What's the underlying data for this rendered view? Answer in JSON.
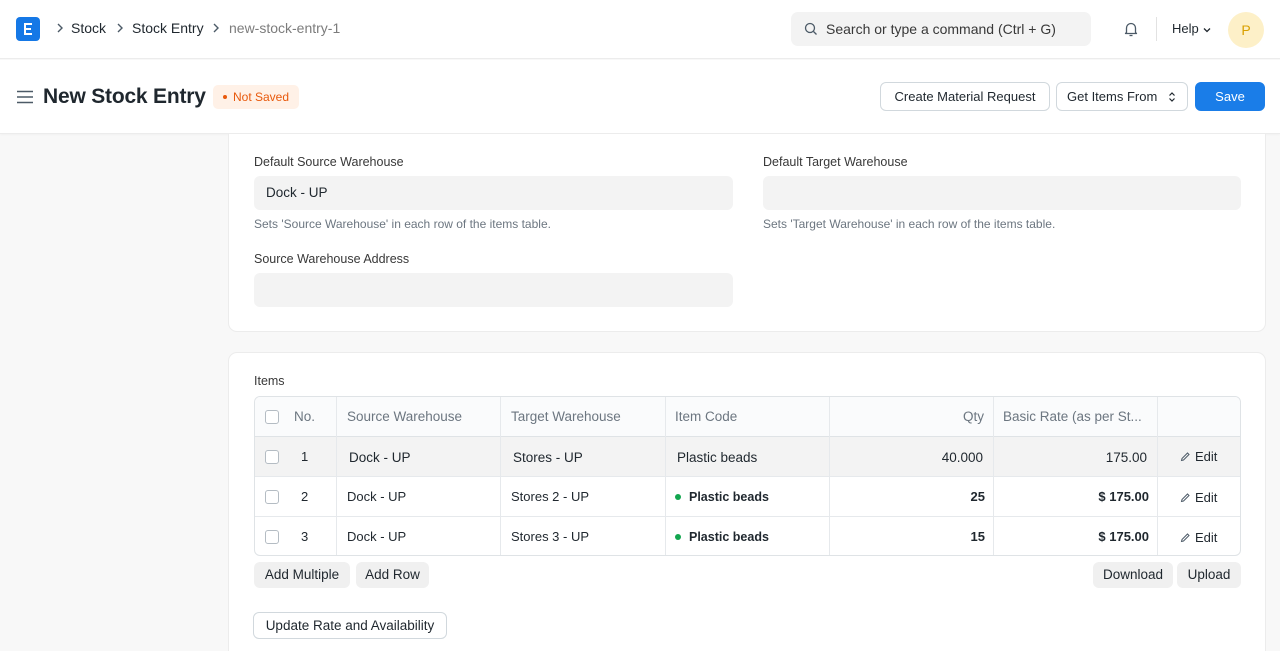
{
  "navbar": {
    "breadcrumbs": [
      "Stock",
      "Stock Entry",
      "new-stock-entry-1"
    ],
    "search_placeholder": "Search or type a command (Ctrl + G)",
    "help_label": "Help",
    "avatar_initial": "P"
  },
  "page": {
    "title": "New Stock Entry",
    "status": "Not Saved",
    "actions": {
      "create_material_request": "Create Material Request",
      "get_items_from": "Get Items From",
      "save": "Save"
    }
  },
  "warehouse_section": {
    "default_source_warehouse": {
      "label": "Default Source Warehouse",
      "value": "Dock - UP",
      "description": "Sets 'Source Warehouse' in each row of the items table."
    },
    "default_target_warehouse": {
      "label": "Default Target Warehouse",
      "value": "",
      "description": "Sets 'Target Warehouse' in each row of the items table."
    },
    "source_warehouse_address": {
      "label": "Source Warehouse Address",
      "value": ""
    }
  },
  "items_section": {
    "label": "Items",
    "columns": [
      "No.",
      "Source Warehouse",
      "Target Warehouse",
      "Item Code",
      "Qty",
      "Basic Rate (as per St..."
    ],
    "rows": [
      {
        "no": "1",
        "source": "Dock - UP",
        "target": "Stores - UP",
        "item": "Plastic beads",
        "qty": "40.000",
        "rate": "175.00",
        "edit": "Edit"
      },
      {
        "no": "2",
        "source": "Dock - UP",
        "target": "Stores 2 - UP",
        "item": "Plastic beads",
        "qty": "25",
        "rate": "$ 175.00",
        "edit": "Edit"
      },
      {
        "no": "3",
        "source": "Dock - UP",
        "target": "Stores 3 - UP",
        "item": "Plastic beads",
        "qty": "15",
        "rate": "$ 175.00",
        "edit": "Edit"
      }
    ],
    "buttons": {
      "add_multiple": "Add Multiple",
      "add_row": "Add Row",
      "download": "Download",
      "upload": "Upload",
      "update_rate": "Update Rate and Availability"
    }
  },
  "colors": {
    "primary": "#1a7de8",
    "status_orange": "#e8590c",
    "indicator_green": "#12a64f"
  }
}
